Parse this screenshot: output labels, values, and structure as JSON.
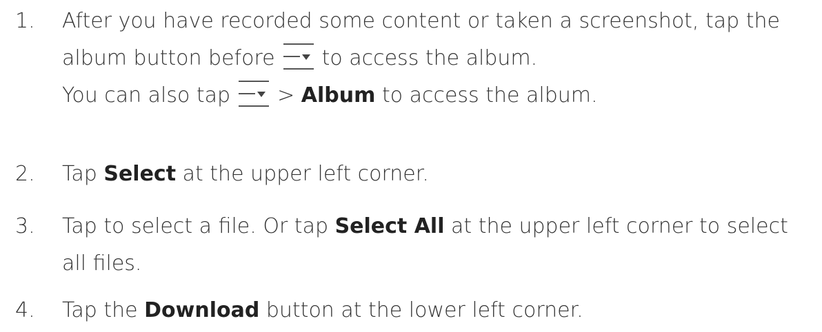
{
  "steps": [
    {
      "number": "1.",
      "line1": "After you have recorded some content or taken a screenshot, tap the",
      "line2_before": "album button before",
      "line2_after": "to access the album.",
      "line3_before": "You can also tap",
      "line3_gt": ">",
      "line3_bold": "Album",
      "line3_after": "to access the album.",
      "icon": "menu-dropdown-icon"
    },
    {
      "number": "2.",
      "before": "Tap",
      "bold": "Select",
      "after": "at the upper left corner."
    },
    {
      "number": "3.",
      "before": "Tap to select a file. Or tap",
      "bold": "Select All",
      "after": "at the upper left corner to select all files."
    },
    {
      "number": "4.",
      "before": "Tap the",
      "bold": "Download",
      "after": "button at the lower left corner."
    }
  ]
}
